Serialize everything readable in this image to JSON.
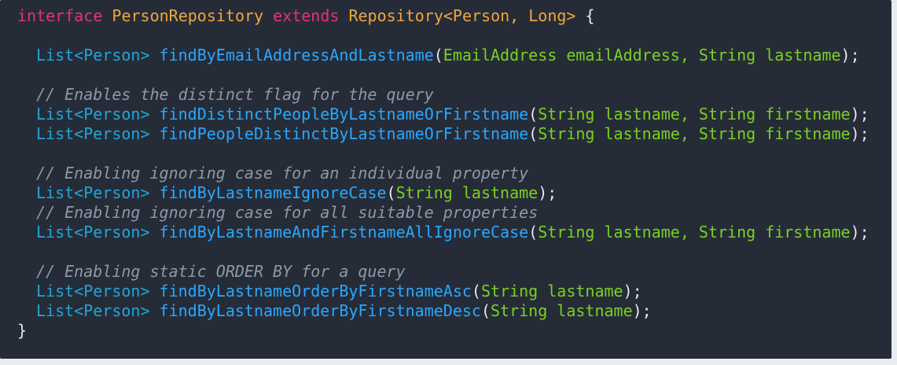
{
  "code": {
    "decl": {
      "kw_interface": "interface",
      "name": "PersonRepository",
      "kw_extends": "extends",
      "parent": "Repository<Person, Long>",
      "open": " {"
    },
    "m1": {
      "ret": "List<Person>",
      "name": "findByEmailAddressAndLastname",
      "params": "EmailAddress emailAddress, String lastname"
    },
    "comment1": "// Enables the distinct flag for the query",
    "m2": {
      "ret": "List<Person>",
      "name": "findDistinctPeopleByLastnameOrFirstname",
      "params": "String lastname, String firstname"
    },
    "m3": {
      "ret": "List<Person>",
      "name": "findPeopleDistinctByLastnameOrFirstname",
      "params": "String lastname, String firstname"
    },
    "comment2": "// Enabling ignoring case for an individual property",
    "m4": {
      "ret": "List<Person>",
      "name": "findByLastnameIgnoreCase",
      "params": "String lastname"
    },
    "comment3": "// Enabling ignoring case for all suitable properties",
    "m5": {
      "ret": "List<Person>",
      "name": "findByLastnameAndFirstnameAllIgnoreCase",
      "params": "String lastname, String firstname"
    },
    "comment4": "// Enabling static ORDER BY for a query",
    "m6": {
      "ret": "List<Person>",
      "name": "findByLastnameOrderByFirstnameAsc",
      "params": "String lastname"
    },
    "m7": {
      "ret": "List<Person>",
      "name": "findByLastnameOrderByFirstnameDesc",
      "params": "String lastname"
    },
    "close": "}",
    "punct": {
      "open_paren": "(",
      "close_paren_semi": ");",
      "space": " "
    }
  }
}
